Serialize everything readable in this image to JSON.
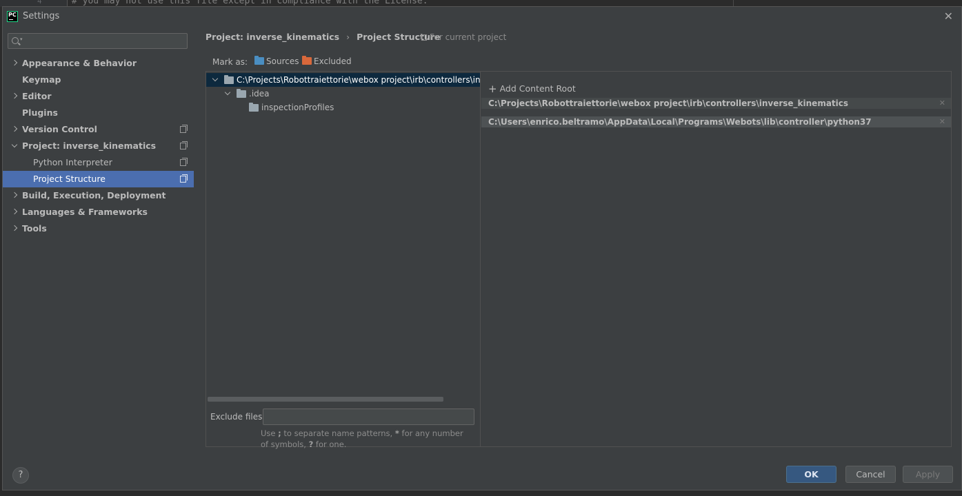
{
  "background_editor": {
    "line_number": "4",
    "code_line": "# you may not use this file except in compliance with the License."
  },
  "window": {
    "title": "Settings",
    "app_icon_text": "PC"
  },
  "search": {
    "value": "",
    "placeholder": ""
  },
  "sidebar": {
    "items": [
      {
        "label": "Appearance & Behavior",
        "expandable": true,
        "expanded": false
      },
      {
        "label": "Keymap",
        "expandable": false
      },
      {
        "label": "Editor",
        "expandable": true,
        "expanded": false
      },
      {
        "label": "Plugins",
        "expandable": false
      },
      {
        "label": "Version Control",
        "expandable": true,
        "expanded": false,
        "project_icon": true
      },
      {
        "label": "Project: inverse_kinematics",
        "expandable": true,
        "expanded": true,
        "project_icon": true
      },
      {
        "label": "Python Interpreter",
        "child": true,
        "project_icon": true
      },
      {
        "label": "Project Structure",
        "child": true,
        "project_icon": true,
        "selected": true
      },
      {
        "label": "Build, Execution, Deployment",
        "expandable": true,
        "expanded": false
      },
      {
        "label": "Languages & Frameworks",
        "expandable": true,
        "expanded": false
      },
      {
        "label": "Tools",
        "expandable": true,
        "expanded": false
      }
    ]
  },
  "header": {
    "crumb_project": "Project: inverse_kinematics",
    "crumb_separator": "›",
    "crumb_page": "Project Structure",
    "for_current": "For current project"
  },
  "mark_as": {
    "label": "Mark as:",
    "sources": "Sources",
    "excluded": "Excluded"
  },
  "tree": {
    "root": "C:\\Projects\\Robottraiettorie\\webox project\\irb\\controllers\\inverse_kinematics",
    "child": ".idea",
    "grandchild": "inspectionProfiles"
  },
  "exclude": {
    "label": "Exclude files:",
    "value": "",
    "hint_1": "Use ",
    "hint_sep": ";",
    "hint_2": " to separate name patterns, ",
    "hint_star": "*",
    "hint_3": " for any number of symbols, ",
    "hint_q": "?",
    "hint_4": " for one."
  },
  "content_roots": {
    "add_label": "Add Content Root",
    "roots": [
      "C:\\Projects\\Robottraiettorie\\webox project\\irb\\controllers\\inverse_kinematics",
      "C:\\Users\\enrico.beltramo\\AppData\\Local\\Programs\\Webots\\lib\\controller\\python37"
    ]
  },
  "footer": {
    "help": "?",
    "ok": "OK",
    "cancel": "Cancel",
    "apply": "Apply"
  },
  "colors": {
    "selection": "#4b6eaf",
    "sources_folder": "#4a8ec2",
    "excluded_folder": "#d9683b",
    "ok_button": "#365880"
  }
}
